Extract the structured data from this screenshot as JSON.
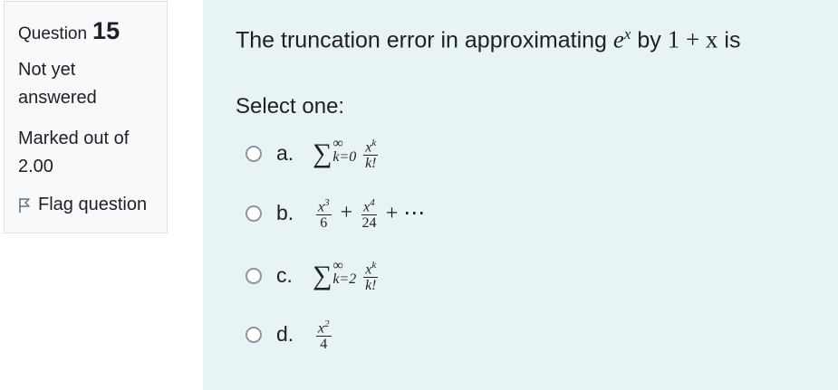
{
  "question": {
    "label": "Question",
    "number": "15",
    "state": "Not yet answered",
    "state_line1": "Not yet",
    "state_line2": "answered",
    "grade_line1": "Marked out of",
    "grade_line2": "2.00",
    "flag_label": "Flag question"
  },
  "content": {
    "text_prefix": "The truncation error in approximating ",
    "text_math1_base": "e",
    "text_math1_exp": "x",
    "text_mid": " by ",
    "text_math2": "1 + x",
    "text_suffix": " is",
    "prompt": "Select one:"
  },
  "options": [
    {
      "letter": "a.",
      "sum_upper": "∞",
      "sum_lower": "k=0",
      "frac_num": "x^k",
      "frac_den": "k!"
    },
    {
      "letter": "b.",
      "t1_num": "x^3",
      "t1_den": "6",
      "t2_num": "x^4",
      "t2_den": "24",
      "plus": "+",
      "tail": "+ ⋯"
    },
    {
      "letter": "c.",
      "sum_upper": "∞",
      "sum_lower": "k=2",
      "frac_num": "x^k",
      "frac_den": "k!"
    },
    {
      "letter": "d.",
      "frac_num": "x^2",
      "frac_den": "4"
    }
  ]
}
